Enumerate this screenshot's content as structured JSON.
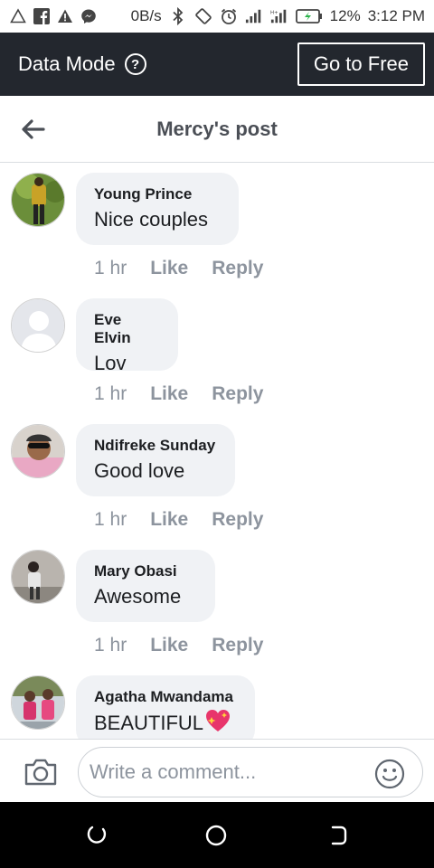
{
  "status_bar": {
    "speed": "0B/s",
    "battery": "12%",
    "time": "3:12 PM",
    "icons": [
      "alert-triangle-outline-icon",
      "facebook-icon",
      "warning-icon",
      "messenger-icon",
      "bluetooth-icon",
      "rotation-icon",
      "alarm-icon",
      "signal-icon",
      "signal-h-icon",
      "battery-charging-icon"
    ]
  },
  "data_mode": {
    "label": "Data Mode",
    "help_icon": "?",
    "go_free_label": "Go to Free"
  },
  "header": {
    "title": "Mercy's post",
    "back_icon": "back-arrow-icon"
  },
  "comments": [
    {
      "author": "Young Prince",
      "text": "Nice couples",
      "time": "1 hr",
      "like": "Like",
      "reply": "Reply"
    },
    {
      "author": "Eve Elvin",
      "text": "Lov",
      "time": "1 hr",
      "like": "Like",
      "reply": "Reply"
    },
    {
      "author": "Ndifreke Sunday",
      "text": "Good love",
      "time": "1 hr",
      "like": "Like",
      "reply": "Reply"
    },
    {
      "author": "Mary Obasi",
      "text": "Awesome",
      "time": "1 hr",
      "like": "Like",
      "reply": "Reply"
    },
    {
      "author": "Agatha Mwandama",
      "text": "BEAUTIFUL",
      "time": "",
      "like": "",
      "reply": ""
    }
  ],
  "composer": {
    "placeholder": "Write a comment...",
    "camera_icon": "camera-icon",
    "emoji_icon": "smiley-icon"
  },
  "nav_bar": {
    "icons": [
      "recent-apps-icon",
      "home-icon",
      "back-icon"
    ]
  },
  "colors": {
    "data_bar": "#23272e",
    "bubble": "#f0f2f5",
    "meta_text": "#8d949e",
    "title_text": "#4b4f56"
  }
}
